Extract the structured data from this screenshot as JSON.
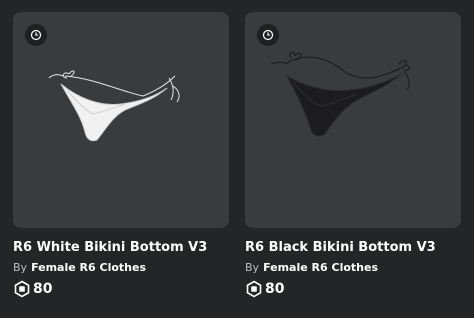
{
  "items": [
    {
      "name": "R6 White Bikini Bottom V3",
      "by_label": "By",
      "creator": "Female R6 Clothes",
      "price": "80",
      "icon": "clock-icon",
      "color": "#ffffff"
    },
    {
      "name": "R6 Black Bikini Bottom V3",
      "by_label": "By",
      "creator": "Female R6 Clothes",
      "price": "80",
      "icon": "clock-icon",
      "color": "#1b1b1d"
    }
  ],
  "colors": {
    "page_bg": "#232527",
    "card_bg": "#393b3d",
    "text": "#ffffff",
    "muted": "#bdbebe"
  }
}
